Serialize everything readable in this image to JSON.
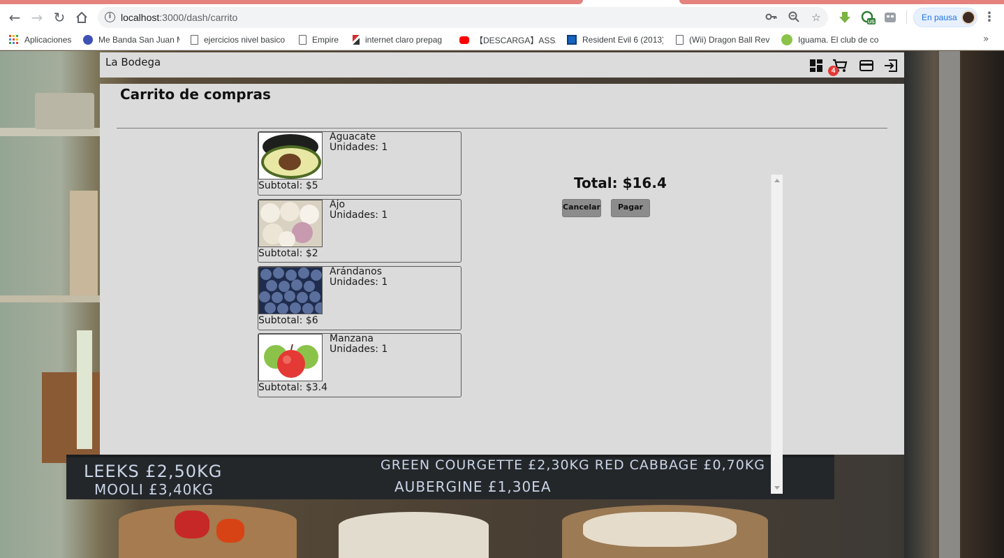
{
  "browser": {
    "url_host": "localhost",
    "url_path": ":3000/dash/carrito",
    "profile_label": "En pausa",
    "extension_badge": "US",
    "bookmarks": [
      {
        "label": "Aplicaciones",
        "icon": "apps-grid-icon"
      },
      {
        "label": "Me Banda San Juan M",
        "icon": "music-icon"
      },
      {
        "label": "ejercicios nivel basico",
        "icon": "page-icon"
      },
      {
        "label": "Empire",
        "icon": "page-icon"
      },
      {
        "label": "internet claro prepag",
        "icon": "claro-icon"
      },
      {
        "label": "【DESCARGA】ASSASS",
        "icon": "youtube-icon"
      },
      {
        "label": "Resident Evil 6 (2013)",
        "icon": "site-d-icon"
      },
      {
        "label": "(Wii) Dragon Ball Rev",
        "icon": "page-icon"
      },
      {
        "label": "Iguama. El club de co",
        "icon": "iguama-icon"
      }
    ]
  },
  "app": {
    "title": "La Bodega",
    "cart_count": "4",
    "header_icons": [
      "dashboard-icon",
      "cart-icon",
      "credit-card-icon",
      "logout-icon"
    ]
  },
  "cart": {
    "title": "Carrito de compras",
    "total_label": "Total: $16.4",
    "cancel_label": "Cancelar",
    "pay_label": "Pagar",
    "items": [
      {
        "name": "Aguacate",
        "units": "Unidades: 1",
        "subtotal": "Subtotal: $5"
      },
      {
        "name": "Ajo",
        "units": "Unidades: 1",
        "subtotal": "Subtotal: $2"
      },
      {
        "name": "Arándanos",
        "units": "Unidades: 1",
        "subtotal": "Subtotal: $6"
      },
      {
        "name": "Manzana",
        "units": "Unidades: 1",
        "subtotal": "Subtotal: $3.4"
      }
    ]
  },
  "background": {
    "chalkboard_line1_left": "LEEKS £2,50KG",
    "chalkboard_line2_left": "MOOLI £3,40KG",
    "chalkboard_line1_right": "GREEN COURGETTE £2,30KG   RED CABBAGE £0,70KG",
    "chalkboard_line2_right": "AUBERGINE £1,30EA"
  },
  "colors": {
    "accent_tab": "#e5827e",
    "badge": "#e53935",
    "panel": "#dbdbdb",
    "button": "#8c8c8c"
  }
}
